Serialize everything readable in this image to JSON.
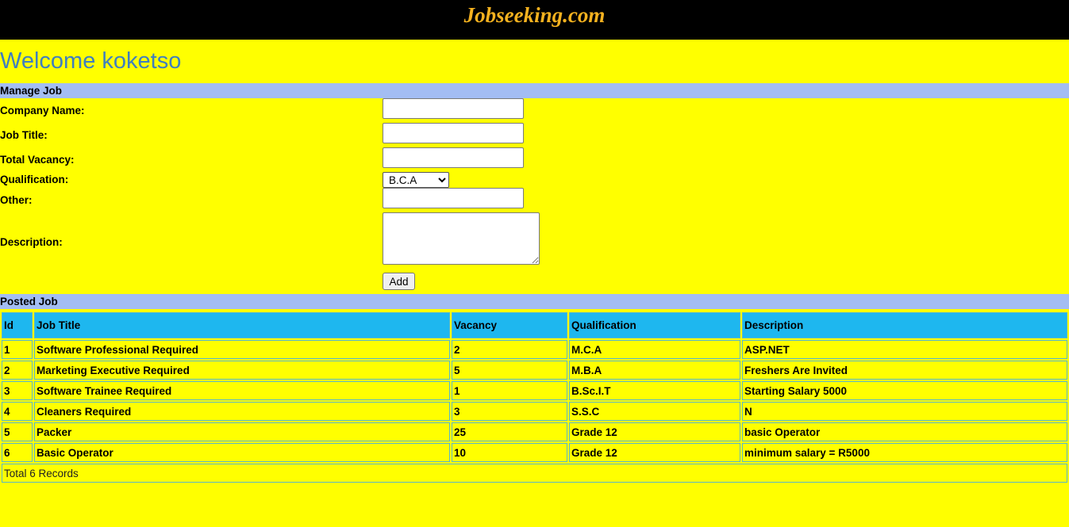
{
  "site": {
    "title": "Jobseeking.com"
  },
  "welcome": {
    "text": "Welcome koketso"
  },
  "manage": {
    "heading": "Manage Job",
    "company_label": "Company Name:",
    "company_value": "",
    "job_title_label": "Job Title:",
    "job_title_value": "",
    "vacancy_label": "Total Vacancy:",
    "vacancy_value": "",
    "qualification_label": "Qualification:",
    "qualification_selected": "B.C.A",
    "other_label": "Other:",
    "other_value": "",
    "description_label": "Description:",
    "description_value": "",
    "add_label": "Add"
  },
  "posted": {
    "heading": "Posted Job",
    "columns": [
      "Id",
      "Job Title",
      "Vacancy",
      "Qualification",
      "Description"
    ],
    "rows": [
      [
        "1",
        "Software Professional Required",
        "2",
        "M.C.A",
        "ASP.NET"
      ],
      [
        "2",
        "Marketing Executive Required",
        "5",
        "M.B.A",
        "Freshers Are Invited"
      ],
      [
        "3",
        "Software Trainee Required",
        "1",
        "B.Sc.I.T",
        "Starting Salary 5000"
      ],
      [
        "4",
        "Cleaners Required",
        "3",
        "S.S.C",
        "N"
      ],
      [
        "5",
        "Packer",
        "25",
        "Grade 12",
        "basic Operator"
      ],
      [
        "6",
        "Basic Operator",
        "10",
        "Grade 12",
        "minimum salary = R5000"
      ]
    ],
    "footer": "Total 6 Records"
  },
  "colors": {
    "page_background": "#ffff00",
    "header_background": "#000000",
    "brand": "#f5b21f",
    "welcome_text": "#3f7fbf",
    "section_bar": "#a3bdf3",
    "table_header": "#1eb7ef",
    "table_border": "#5ab7c9"
  }
}
